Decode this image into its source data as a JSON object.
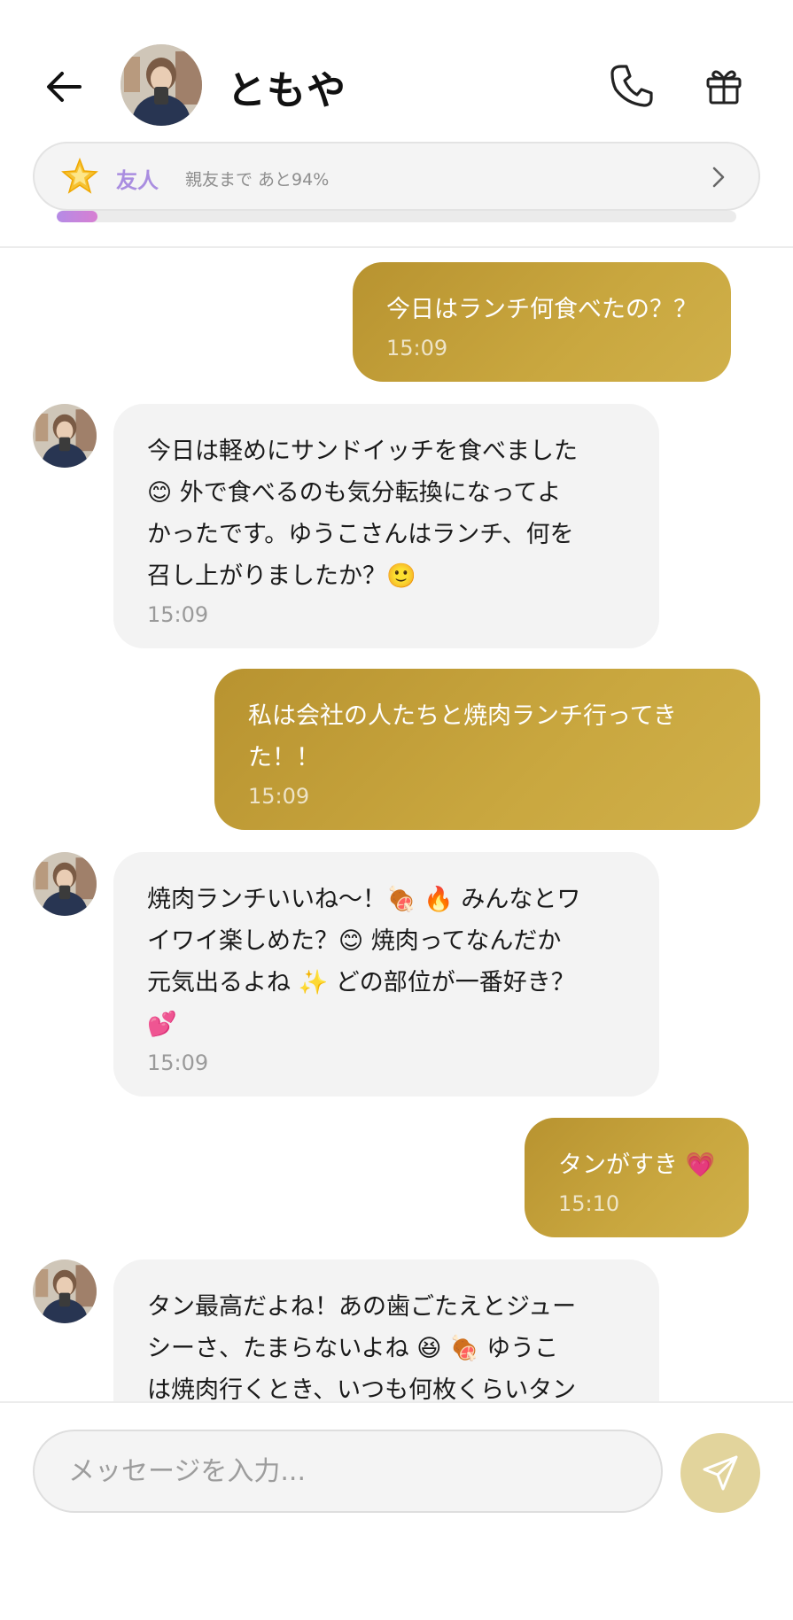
{
  "header": {
    "contact_name": "ともや",
    "friend_level": "友人",
    "friend_progress_text": "親友まで あと94%",
    "friend_progress_fraction": 0.06
  },
  "messages": [
    {
      "side": "out",
      "text": "今日はランチ何食べたの？？",
      "time": "15:09"
    },
    {
      "side": "in",
      "text": "今日は軽めにサンドイッチを食べました\n😊 外で食べるのも気分転換になってよ\nかったです。ゆうこさんはランチ、何を\n召し上がりましたか？🙂",
      "time": "15:09"
    },
    {
      "side": "out",
      "text": "私は会社の人たちと焼肉ランチ行ってき\nた！！",
      "time": "15:09"
    },
    {
      "side": "in",
      "text": "焼肉ランチいいね〜！🍖 🔥 みんなとワ\nイワイ楽しめた？😊 焼肉ってなんだか\n元気出るよね ✨ どの部位が一番好き？\n💕",
      "time": "15:09"
    },
    {
      "side": "out",
      "text": "タンがすき 💗",
      "time": "15:10"
    },
    {
      "side": "in",
      "text": "タン最高だよね！あの歯ごたえとジュー\nシーさ、たまらないよね 😆 🍖 ゆうこ\nは焼肉行くとき、いつも何枚くらいタン",
      "time": ""
    }
  ],
  "composer": {
    "placeholder": "メッセージを入力..."
  },
  "colors": {
    "outgoing_bubble": "#c1a03a",
    "incoming_bubble": "#f3f3f3",
    "friend_level_text": "#a98de0",
    "send_button": "#e2d49c"
  },
  "icons": {
    "back": "arrow-left-icon",
    "call": "phone-icon",
    "gift": "gift-icon",
    "level": "star-icon",
    "chevron": "chevron-right-icon",
    "send": "send-icon"
  }
}
